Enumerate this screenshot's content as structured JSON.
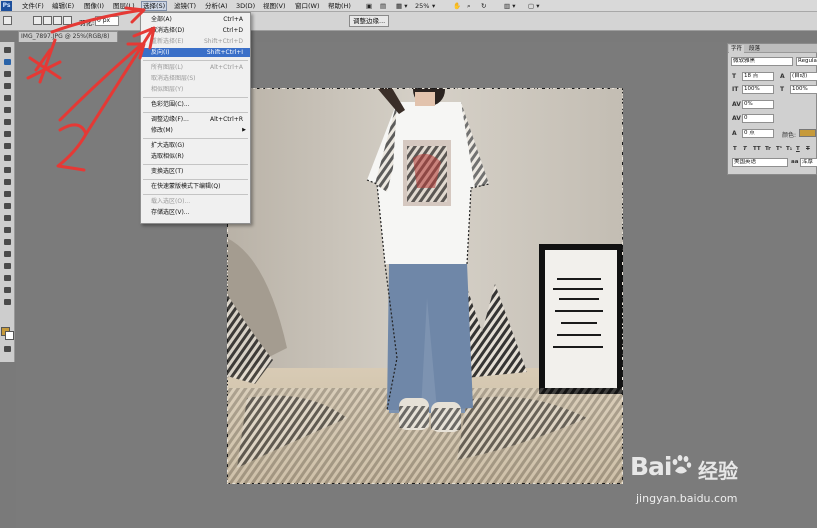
{
  "menubar": {
    "logo": "Ps",
    "items": [
      "文件(F)",
      "编辑(E)",
      "图像(I)",
      "图层(L)",
      "选择(S)",
      "滤镜(T)",
      "分析(A)",
      "3D(D)",
      "视图(V)",
      "窗口(W)",
      "帮助(H)"
    ],
    "zoom": "25%"
  },
  "options": {
    "feather_label": "羽化:",
    "feather_value": "0 px",
    "refine_button": "调整边缘..."
  },
  "document": {
    "tab_title": "IMG_7897.JPG @ 25%(RGB/8)"
  },
  "select_menu": {
    "items": [
      {
        "label": "全部(A)",
        "shortcut": "Ctrl+A",
        "state": "normal"
      },
      {
        "label": "取消选择(D)",
        "shortcut": "Ctrl+D",
        "state": "normal"
      },
      {
        "label": "重新选择(E)",
        "shortcut": "Shift+Ctrl+D",
        "state": "disabled"
      },
      {
        "label": "反向(I)",
        "shortcut": "Shift+Ctrl+I",
        "state": "highlight"
      },
      {
        "label": "所有图层(L)",
        "shortcut": "Alt+Ctrl+A",
        "state": "disabled"
      },
      {
        "label": "取消选择图层(S)",
        "shortcut": "",
        "state": "disabled"
      },
      {
        "label": "相似图层(Y)",
        "shortcut": "",
        "state": "disabled"
      },
      {
        "label": "色彩范围(C)...",
        "shortcut": "",
        "state": "normal"
      },
      {
        "label": "调整边缘(F)...",
        "shortcut": "Alt+Ctrl+R",
        "state": "normal"
      },
      {
        "label": "修改(M)",
        "shortcut": "",
        "state": "submenu"
      },
      {
        "label": "扩大选取(G)",
        "shortcut": "",
        "state": "normal"
      },
      {
        "label": "选取相似(R)",
        "shortcut": "",
        "state": "normal"
      },
      {
        "label": "变换选区(T)",
        "shortcut": "",
        "state": "normal"
      },
      {
        "label": "在快速蒙版模式下编辑(Q)",
        "shortcut": "",
        "state": "normal"
      },
      {
        "label": "载入选区(O)...",
        "shortcut": "",
        "state": "disabled"
      },
      {
        "label": "存储选区(V)...",
        "shortcut": "",
        "state": "normal"
      }
    ]
  },
  "character_panel": {
    "tabs": [
      "字符",
      "段落"
    ],
    "font_family": "微软雅黑",
    "font_style": "Regular",
    "font_size": "18 点",
    "leading": "(自动)",
    "vertical_scale": "100%",
    "horizontal_scale": "100%",
    "tracking": "0%",
    "kerning": "0",
    "baseline_shift": "0 点",
    "color_label": "颜色:",
    "language": "美国英语",
    "antialias": "浑厚",
    "color": "#c69a3b"
  },
  "watermark": {
    "brand": "Bai",
    "brand_cn": "经验",
    "url": "jingyan.baidu.com"
  },
  "colors": {
    "menu_highlight": "#3a6fc8",
    "annotation_red": "#e53935",
    "foreground_swatch": "#c69a3b"
  }
}
